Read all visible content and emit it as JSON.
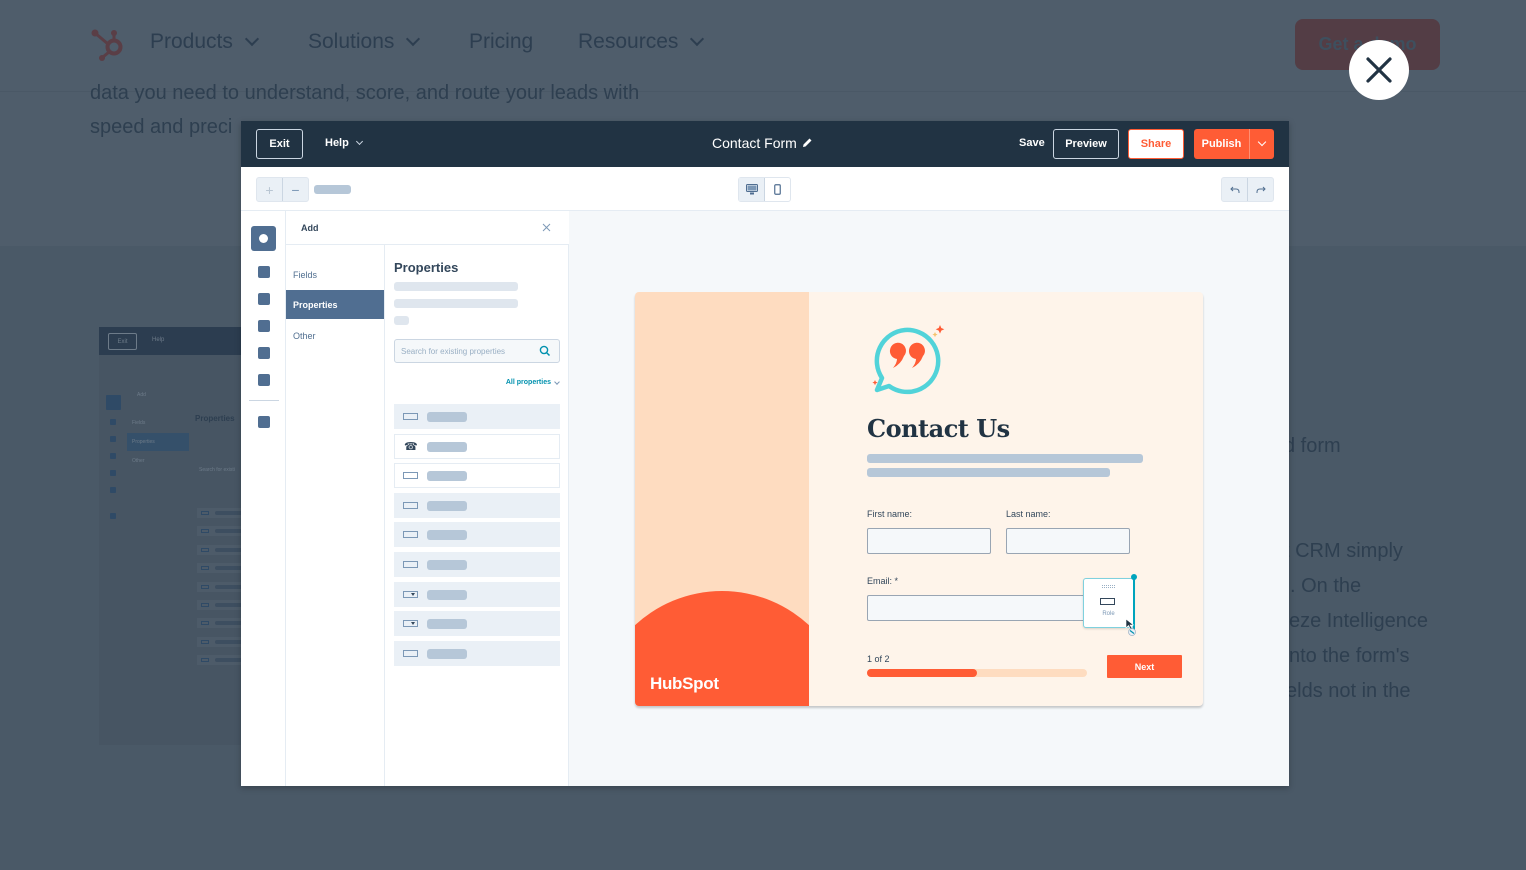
{
  "background_page": {
    "nav": [
      {
        "label": "Products",
        "has_dropdown": true
      },
      {
        "label": "Solutions",
        "has_dropdown": true
      },
      {
        "label": "Pricing",
        "has_dropdown": false
      },
      {
        "label": "Resources",
        "has_dropdown": true
      }
    ],
    "cta_label": "Get a demo",
    "intro_lines": [
      "data you need to understand, score, and route your leads with",
      "speed and preci"
    ],
    "body_lines": [
      "d form",
      "t CRM simply",
      ". On the",
      "eze Intelligence",
      "nto the form's",
      "elds not in the"
    ],
    "thumbnail": {
      "exit": "Exit",
      "help": "Help",
      "add": "Add",
      "categories": [
        "Fields",
        "Properties",
        "Other"
      ],
      "properties_title": "Properties",
      "search_placeholder": "Search for existi"
    }
  },
  "modal": {
    "close_icon": "close-icon"
  },
  "editor": {
    "topbar": {
      "exit_label": "Exit",
      "help_label": "Help",
      "title": "Contact Form",
      "save_label": "Save",
      "preview_label": "Preview",
      "share_label": "Share",
      "publish_label": "Publish"
    },
    "panel": {
      "title": "Add",
      "categories": [
        {
          "label": "Fields",
          "selected": false
        },
        {
          "label": "Properties",
          "selected": true
        },
        {
          "label": "Other",
          "selected": false
        }
      ],
      "properties_title": "Properties",
      "search_placeholder": "Search for existing properties",
      "filter_label": "All properties",
      "property_rows": [
        {
          "icon": "text-field-icon",
          "highlighted": false
        },
        {
          "icon": "phone-icon",
          "highlighted": true
        },
        {
          "icon": "number-field-icon",
          "highlighted": true
        },
        {
          "icon": "text-field-icon",
          "highlighted": false
        },
        {
          "icon": "text-field-icon",
          "highlighted": false
        },
        {
          "icon": "text-field-icon",
          "highlighted": false
        },
        {
          "icon": "dropdown-field-icon",
          "highlighted": false
        },
        {
          "icon": "dropdown-field-icon",
          "highlighted": false
        },
        {
          "icon": "text-field-icon",
          "highlighted": false
        }
      ]
    },
    "form_preview": {
      "brand": "HubSpot",
      "heading": "Contact Us",
      "first_name_label": "First name:",
      "last_name_label": "Last name:",
      "email_label": "Email: *",
      "step_label": "1 of 2",
      "progress_fraction": 0.5,
      "next_label": "Next",
      "dragged_field_label": "Role"
    },
    "colors": {
      "accent": "#ff5c35",
      "topbar": "#213343",
      "selected": "#506e91",
      "teal": "#00a4bd"
    }
  }
}
